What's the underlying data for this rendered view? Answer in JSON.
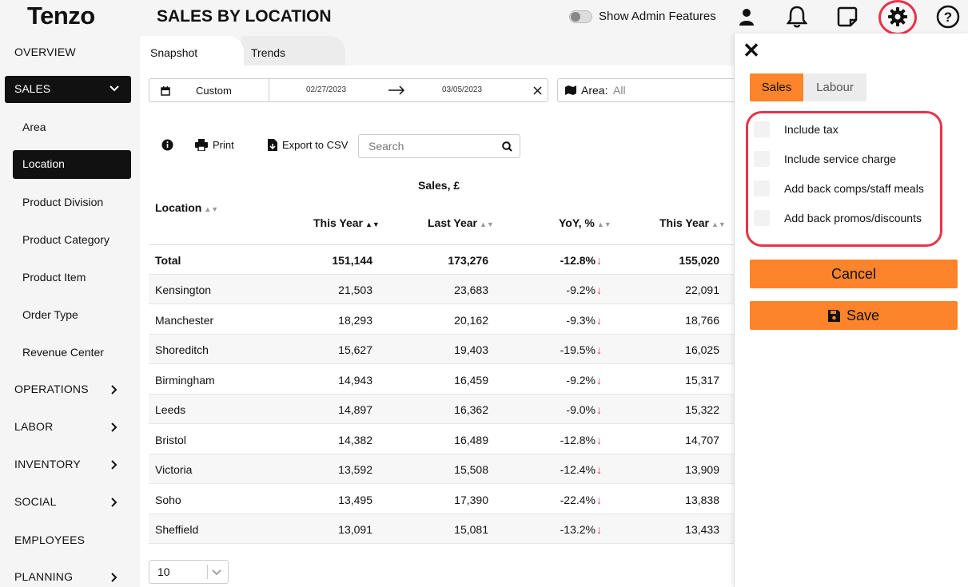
{
  "header": {
    "logo": "Tenzo",
    "title": "SALES BY LOCATION",
    "admin_label": "Show Admin Features"
  },
  "sidebar": {
    "top": [
      {
        "label": "OVERVIEW"
      },
      {
        "label": "SALES"
      }
    ],
    "sub": [
      "Area",
      "Location",
      "Product Division",
      "Product Category",
      "Product Item",
      "Order Type",
      "Revenue Center"
    ],
    "sections": [
      "OPERATIONS",
      "LABOR",
      "INVENTORY",
      "SOCIAL",
      "EMPLOYEES",
      "PLANNING"
    ]
  },
  "tabs": [
    "Snapshot",
    "Trends"
  ],
  "filters": {
    "date_mode": "Custom",
    "date_from": "02/27/2023",
    "date_to": "03/05/2023",
    "area_label": "Area:",
    "area_value": "All"
  },
  "toolbar": {
    "print": "Print",
    "export": "Export to CSV",
    "search_placeholder": "Search"
  },
  "table": {
    "group_header": "Sales, £",
    "columns": [
      "Location",
      "This Year",
      "Last Year",
      "YoY, %",
      "This Year"
    ],
    "total": {
      "location": "Total",
      "this_year": "151,144",
      "last_year": "173,276",
      "yoy": "-12.8%",
      "this_year2": "155,020"
    },
    "rows": [
      {
        "location": "Kensington",
        "this_year": "21,503",
        "last_year": "23,683",
        "yoy": "-9.2%",
        "this_year2": "22,091"
      },
      {
        "location": "Manchester",
        "this_year": "18,293",
        "last_year": "20,162",
        "yoy": "-9.3%",
        "this_year2": "18,766"
      },
      {
        "location": "Shoreditch",
        "this_year": "15,627",
        "last_year": "19,403",
        "yoy": "-19.5%",
        "this_year2": "16,025"
      },
      {
        "location": "Birmingham",
        "this_year": "14,943",
        "last_year": "16,459",
        "yoy": "-9.2%",
        "this_year2": "15,317"
      },
      {
        "location": "Leeds",
        "this_year": "14,897",
        "last_year": "16,362",
        "yoy": "-9.0%",
        "this_year2": "15,322"
      },
      {
        "location": "Bristol",
        "this_year": "14,382",
        "last_year": "16,489",
        "yoy": "-12.8%",
        "this_year2": "14,707"
      },
      {
        "location": "Victoria",
        "this_year": "13,592",
        "last_year": "15,508",
        "yoy": "-12.4%",
        "this_year2": "13,909"
      },
      {
        "location": "Soho",
        "this_year": "13,495",
        "last_year": "17,390",
        "yoy": "-22.4%",
        "this_year2": "13,838"
      },
      {
        "location": "Sheffield",
        "this_year": "13,091",
        "last_year": "15,081",
        "yoy": "-13.2%",
        "this_year2": "13,433"
      }
    ],
    "page_size": "10"
  },
  "drawer": {
    "tabs": [
      "Sales",
      "Labour"
    ],
    "options": [
      "Include tax",
      "Include service charge",
      "Add back comps/staff meals",
      "Add back promos/discounts"
    ],
    "cancel": "Cancel",
    "save": "Save"
  },
  "colors": {
    "accent": "#fd842a",
    "highlight": "#e8334a",
    "nav_active": "#111111"
  }
}
